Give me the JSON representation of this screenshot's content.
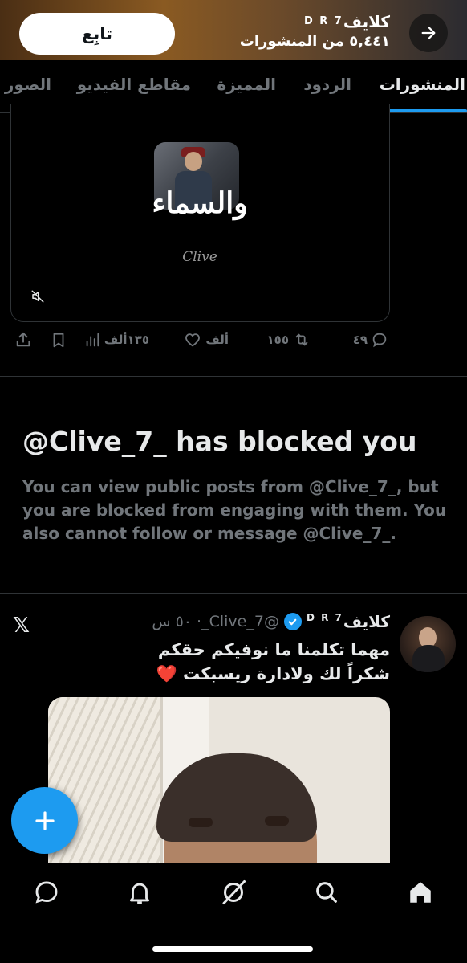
{
  "header": {
    "follow_label": "تابِع",
    "name": "كلايف",
    "name_suffix": "D R 7",
    "post_count": "٥,٤٤١ من المنشورات"
  },
  "tabs": [
    {
      "label": "المنشورات",
      "active": true
    },
    {
      "label": "الردود",
      "active": false
    },
    {
      "label": "المميزة",
      "active": false
    },
    {
      "label": "مقاطع الفيديو",
      "active": false
    },
    {
      "label": "الصور",
      "active": false
    }
  ],
  "previous_post": {
    "media_caption": "والسماء",
    "media_watermark": "Clive",
    "replies": "٤٩",
    "reposts": "١٥٥",
    "likes": "ألف",
    "views": "١٣٥ألف"
  },
  "blocked": {
    "title": "@Clive_7_ has blocked you",
    "description": "You can view public posts from @Clive_7_, but you are blocked from engaging with them. You also cannot follow or message @Clive_7_."
  },
  "post": {
    "name": "كلايف",
    "name_suffix": "D R 7",
    "handle_time": "@Clive_7_· ٥٠ س",
    "text_line1": "مهما تكلمنا ما نوفيكم حقكم",
    "text_line2": "شكراً لك ولادارة ريسبكت",
    "emoji": "❤️",
    "platform_icon": "𝕏"
  },
  "colors": {
    "accent": "#1d9bf0",
    "background": "#000000",
    "text_primary": "#e7e9ea",
    "text_secondary": "#71767b"
  }
}
